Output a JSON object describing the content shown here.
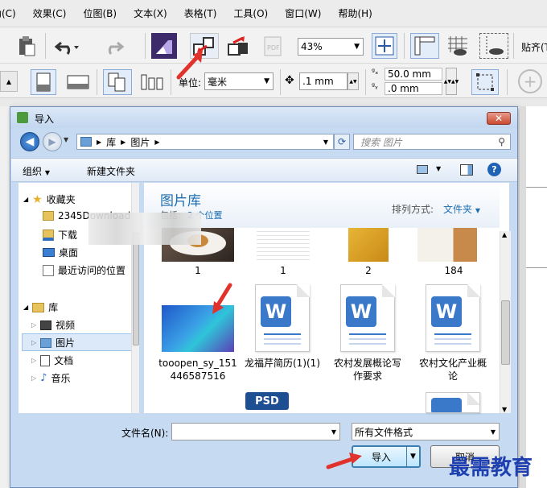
{
  "menubar": {
    "items": [
      "帮助(C)",
      "效果(C)",
      "位图(B)",
      "文本(X)",
      "表格(T)",
      "工具(O)",
      "窗口(W)",
      "帮助(H)"
    ]
  },
  "toolbar1": {
    "zoom": "43%",
    "snap_label": "贴齐(T)"
  },
  "toolbar2": {
    "unit_label": "单位:",
    "unit_value": "毫米",
    "nudge_value": ".1 mm",
    "dup_x": "50.0 mm",
    "dup_y": ".0 mm"
  },
  "dialog": {
    "title": "导入",
    "address": {
      "segments": [
        "库",
        "图片"
      ]
    },
    "search_placeholder": "搜索 图片",
    "command_bar": {
      "organize": "组织",
      "new_folder": "新建文件夹"
    },
    "nav": {
      "favorites": "收藏夹",
      "fav_items": [
        "2345Downloads",
        "下载",
        "桌面",
        "最近访问的位置"
      ],
      "libraries": "库",
      "lib_items": [
        "视频",
        "图片",
        "文档",
        "音乐"
      ],
      "selected": "图片"
    },
    "library": {
      "title": "图片库",
      "includes_label": "包括:",
      "includes_link": "2 个位置",
      "arrange_label": "排列方式:",
      "arrange_value": "文件夹"
    },
    "files_row1": [
      "1",
      "1",
      "2",
      "184"
    ],
    "files_row2": [
      {
        "name": "tooopen_sy_151446587516",
        "line1": "tooopen_sy_151",
        "line2": "446587516"
      },
      {
        "name": "龙福芹简历(1)(1)",
        "line1": "龙福芹简历(1)(1)",
        "line2": ""
      },
      {
        "name": "农村发展概论写作要求",
        "line1": "农村发展概论写",
        "line2": "作要求"
      },
      {
        "name": "农村文化产业概论",
        "line1": "农村文化产业概",
        "line2": "论"
      }
    ],
    "psd_label": "PSD",
    "filename_label": "文件名(N):",
    "filename_value": "",
    "filetype_value": "所有文件格式",
    "import_button": "导入",
    "cancel_button": "取消"
  },
  "watermark": "最需教育",
  "colors": {
    "accent": "#3a78c9",
    "annotation": "#e0332b",
    "library_title": "#1e6fb3"
  }
}
